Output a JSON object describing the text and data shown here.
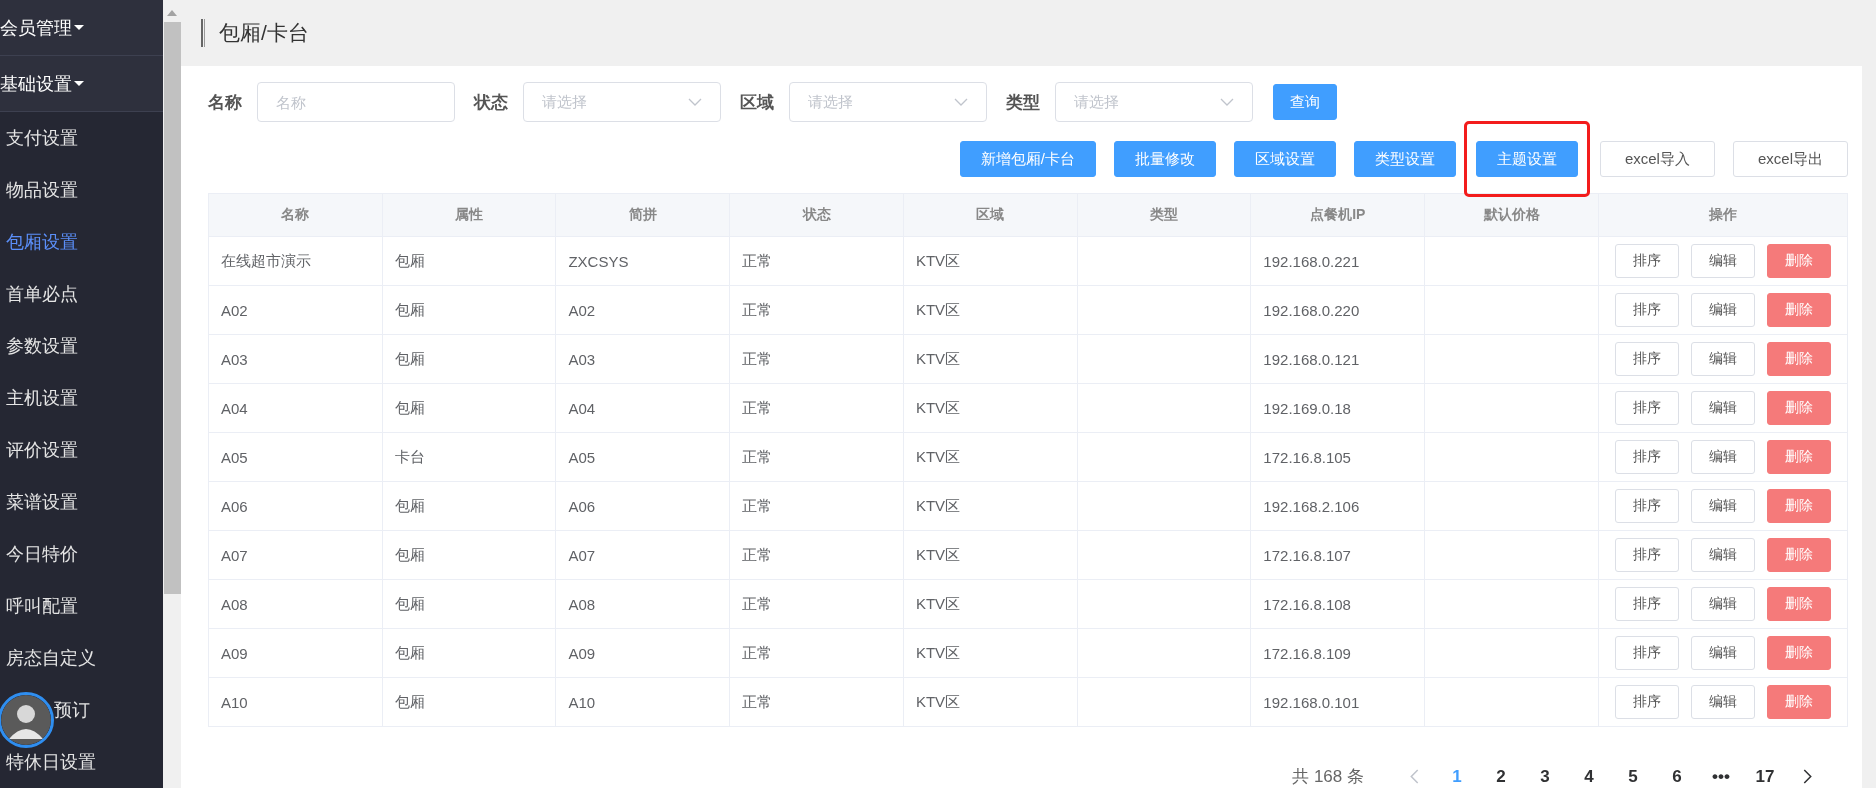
{
  "sidebar": {
    "groups": [
      {
        "label": "会员管理",
        "expanded": true
      },
      {
        "label": "基础设置",
        "expanded": true
      }
    ],
    "items": [
      {
        "label": "支付设置",
        "selected": false
      },
      {
        "label": "物品设置",
        "selected": false
      },
      {
        "label": "包厢设置",
        "selected": true
      },
      {
        "label": "首单必点",
        "selected": false
      },
      {
        "label": "参数设置",
        "selected": false
      },
      {
        "label": "主机设置",
        "selected": false
      },
      {
        "label": "评价设置",
        "selected": false
      },
      {
        "label": "菜谱设置",
        "selected": false
      },
      {
        "label": "今日特价",
        "selected": false
      },
      {
        "label": "呼叫配置",
        "selected": false
      },
      {
        "label": "房态自定义",
        "selected": false
      },
      {
        "label": "预订",
        "selected": false,
        "covered": true
      },
      {
        "label": "特休日设置",
        "selected": false
      }
    ]
  },
  "page_title": "包厢/卡台",
  "filters": [
    {
      "label": "名称",
      "kind": "input",
      "placeholder": "名称"
    },
    {
      "label": "状态",
      "kind": "select",
      "placeholder": "请选择"
    },
    {
      "label": "区域",
      "kind": "select",
      "placeholder": "请选择"
    },
    {
      "label": "类型",
      "kind": "select",
      "placeholder": "请选择"
    }
  ],
  "query_button": "查询",
  "actions": [
    {
      "label": "新增包厢/卡台",
      "kind": "primary",
      "highlighted": false
    },
    {
      "label": "批量修改",
      "kind": "primary",
      "highlighted": false
    },
    {
      "label": "区域设置",
      "kind": "primary",
      "highlighted": false
    },
    {
      "label": "类型设置",
      "kind": "primary",
      "highlighted": false
    },
    {
      "label": "主题设置",
      "kind": "primary",
      "highlighted": true
    },
    {
      "label": "excel导入",
      "kind": "plain",
      "highlighted": false
    },
    {
      "label": "excel导出",
      "kind": "plain",
      "highlighted": false
    }
  ],
  "table": {
    "columns": [
      "名称",
      "属性",
      "简拼",
      "状态",
      "区域",
      "类型",
      "点餐机IP",
      "默认价格",
      "操作"
    ],
    "rows": [
      {
        "cells": [
          "在线超市演示",
          "包厢",
          "ZXCSYS",
          "正常",
          "KTV区",
          "",
          "192.168.0.221",
          ""
        ],
        "actions": [
          "排序",
          "编辑",
          "删除"
        ]
      },
      {
        "cells": [
          "A02",
          "包厢",
          "A02",
          "正常",
          "KTV区",
          "",
          "192.168.0.220",
          ""
        ],
        "actions": [
          "排序",
          "编辑",
          "删除"
        ]
      },
      {
        "cells": [
          "A03",
          "包厢",
          "A03",
          "正常",
          "KTV区",
          "",
          "192.168.0.121",
          ""
        ],
        "actions": [
          "排序",
          "编辑",
          "删除"
        ]
      },
      {
        "cells": [
          "A04",
          "包厢",
          "A04",
          "正常",
          "KTV区",
          "",
          "192.169.0.18",
          ""
        ],
        "actions": [
          "排序",
          "编辑",
          "删除"
        ]
      },
      {
        "cells": [
          "A05",
          "卡台",
          "A05",
          "正常",
          "KTV区",
          "",
          "172.16.8.105",
          ""
        ],
        "actions": [
          "排序",
          "编辑",
          "删除"
        ]
      },
      {
        "cells": [
          "A06",
          "包厢",
          "A06",
          "正常",
          "KTV区",
          "",
          "192.168.2.106",
          ""
        ],
        "actions": [
          "排序",
          "编辑",
          "删除"
        ]
      },
      {
        "cells": [
          "A07",
          "包厢",
          "A07",
          "正常",
          "KTV区",
          "",
          "172.16.8.107",
          ""
        ],
        "actions": [
          "排序",
          "编辑",
          "删除"
        ]
      },
      {
        "cells": [
          "A08",
          "包厢",
          "A08",
          "正常",
          "KTV区",
          "",
          "172.16.8.108",
          ""
        ],
        "actions": [
          "排序",
          "编辑",
          "删除"
        ]
      },
      {
        "cells": [
          "A09",
          "包厢",
          "A09",
          "正常",
          "KTV区",
          "",
          "172.16.8.109",
          ""
        ],
        "actions": [
          "排序",
          "编辑",
          "删除"
        ]
      },
      {
        "cells": [
          "A10",
          "包厢",
          "A10",
          "正常",
          "KTV区",
          "",
          "192.168.0.101",
          ""
        ],
        "actions": [
          "排序",
          "编辑",
          "删除"
        ]
      }
    ]
  },
  "pagination": {
    "total": "共 168 条",
    "prev_disabled": true,
    "pages": [
      {
        "label": "1",
        "selected": true
      },
      {
        "label": "2",
        "selected": false
      },
      {
        "label": "3",
        "selected": false
      },
      {
        "label": "4",
        "selected": false
      },
      {
        "label": "5",
        "selected": false
      },
      {
        "label": "6",
        "selected": false
      },
      {
        "label": "•••",
        "selected": false
      },
      {
        "label": "17",
        "selected": false
      }
    ]
  }
}
